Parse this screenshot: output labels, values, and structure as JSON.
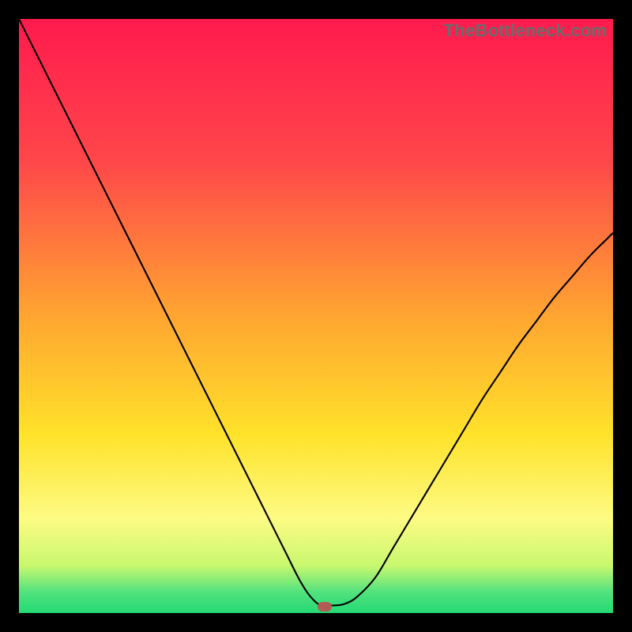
{
  "watermark": "TheBottleneck.com",
  "chart_data": {
    "type": "line",
    "title": "",
    "xlabel": "",
    "ylabel": "",
    "xlim": [
      0,
      100
    ],
    "ylim": [
      0,
      100
    ],
    "grid": false,
    "background_gradient": {
      "stops": [
        {
          "offset": 0.0,
          "color": "#ff1a4e"
        },
        {
          "offset": 0.24,
          "color": "#ff474a"
        },
        {
          "offset": 0.5,
          "color": "#ffa531"
        },
        {
          "offset": 0.7,
          "color": "#ffe22a"
        },
        {
          "offset": 0.84,
          "color": "#fdfb84"
        },
        {
          "offset": 0.92,
          "color": "#c9f86f"
        },
        {
          "offset": 0.965,
          "color": "#51e27e"
        },
        {
          "offset": 1.0,
          "color": "#24d974"
        }
      ]
    },
    "series": [
      {
        "name": "bottleneck-curve",
        "color": "#000000",
        "width": 2.1,
        "x": [
          0,
          3,
          6,
          9,
          12,
          15,
          18,
          21,
          24,
          27,
          30,
          33,
          36,
          39,
          42,
          45,
          47,
          48.5,
          50,
          51,
          52,
          53.5,
          55,
          57,
          60,
          63,
          66,
          69,
          72,
          75,
          78,
          81,
          84,
          87,
          90,
          93,
          96,
          99,
          100
        ],
        "y": [
          100,
          94,
          88,
          82,
          76,
          70,
          64,
          58,
          52,
          46,
          40,
          34,
          28,
          22,
          16,
          10,
          6,
          3.5,
          1.8,
          1.3,
          1.3,
          1.3,
          1.6,
          2.8,
          6,
          11,
          16,
          21,
          26,
          31,
          36,
          40.5,
          45,
          49,
          53,
          56.5,
          60,
          63,
          64
        ]
      }
    ],
    "marker": {
      "x": 51.5,
      "y": 1.0,
      "color": "#b45a56"
    }
  }
}
